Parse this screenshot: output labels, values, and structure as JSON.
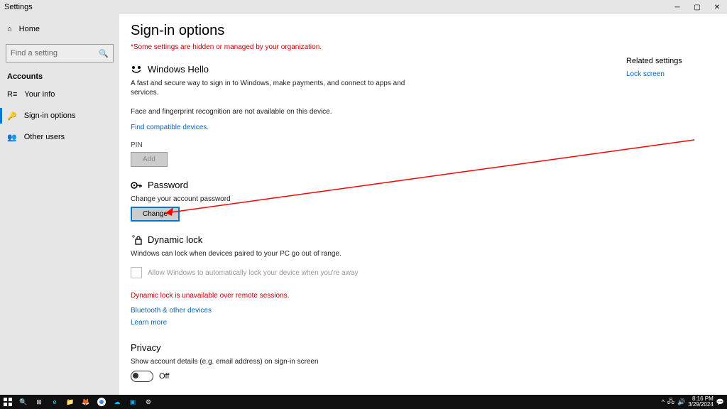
{
  "titlebar": {
    "title": "Settings"
  },
  "sidebar": {
    "home": "Home",
    "search_placeholder": "Find a setting",
    "header": "Accounts",
    "items": [
      {
        "label": "Your info"
      },
      {
        "label": "Sign-in options"
      },
      {
        "label": "Other users"
      }
    ]
  },
  "page": {
    "title": "Sign-in options",
    "org_warning": "*Some settings are hidden or managed by your organization.",
    "hello": {
      "title": "Windows Hello",
      "desc": "A fast and secure way to sign in to Windows, make payments, and connect to apps and services.",
      "note": "Face and fingerprint recognition are not available on this device.",
      "link": "Find compatible devices.",
      "pin_label": "PIN",
      "add_btn": "Add"
    },
    "password": {
      "title": "Password",
      "desc": "Change your account password",
      "change_btn": "Change"
    },
    "dynlock": {
      "title": "Dynamic lock",
      "desc": "Windows can lock when devices paired to your PC go out of range.",
      "checkbox": "Allow Windows to automatically lock your device when you're away",
      "error": "Dynamic lock is unavailable over remote sessions.",
      "link1": "Bluetooth & other devices",
      "link2": "Learn more"
    },
    "privacy": {
      "title": "Privacy",
      "desc": "Show account details (e.g. email address) on sign-in screen",
      "toggle": "Off"
    }
  },
  "related": {
    "header": "Related settings",
    "link": "Lock screen"
  },
  "tray": {
    "time": "8:16 PM",
    "date": "3/29/2024"
  }
}
